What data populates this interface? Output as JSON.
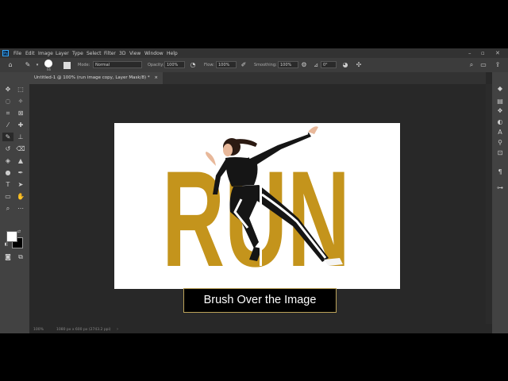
{
  "colors": {
    "run_gold": "#c4941c",
    "caption_border": "#bca35a",
    "ps_blue": "#31a8ff"
  },
  "menubar": {
    "logo": "Ps",
    "items": [
      "File",
      "Edit",
      "Image",
      "Layer",
      "Type",
      "Select",
      "Filter",
      "3D",
      "View",
      "Window",
      "Help"
    ],
    "window_controls": [
      "minimize-icon",
      "restore-icon",
      "close-icon"
    ]
  },
  "options": {
    "brush_size": "66",
    "mode_label": "Mode:",
    "mode_value": "Normal",
    "opacity_label": "Opacity:",
    "opacity_value": "100%",
    "flow_label": "Flow:",
    "flow_value": "100%",
    "smoothing_label": "Smoothing:",
    "smoothing_value": "100%",
    "angle_value": "0°"
  },
  "document": {
    "tab_title": "Untitled-1 @ 100% (run image copy, Layer Mask/8) *",
    "tab_close": "×",
    "zoom": "100%",
    "doc_info": "1080 px x 600 px (2743.2 ppi)"
  },
  "artwork": {
    "word": "RUN"
  },
  "caption": "Brush Over the Image"
}
